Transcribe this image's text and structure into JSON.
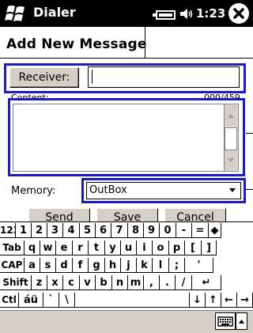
{
  "app": {
    "title": "Dialer",
    "clock": "1:23"
  },
  "page": {
    "title": "Add New Message"
  },
  "receiver": {
    "button_label": "Receiver:",
    "value": ""
  },
  "content": {
    "label": "Content:",
    "counter": "000/459",
    "value": ""
  },
  "memory": {
    "label": "Memory:",
    "selected": "OutBox"
  },
  "actions": {
    "send": "Send",
    "save": "Save",
    "cancel": "Cancel"
  },
  "keyboard": {
    "rows": [
      [
        "123",
        "1",
        "2",
        "3",
        "4",
        "5",
        "6",
        "7",
        "8",
        "9",
        "0",
        "-",
        "=",
        "◆"
      ],
      [
        "Tab",
        "q",
        "w",
        "e",
        "r",
        "t",
        "y",
        "u",
        "i",
        "o",
        "p",
        "[",
        "]"
      ],
      [
        "CAP",
        "a",
        "s",
        "d",
        "f",
        "g",
        "h",
        "j",
        "k",
        "l",
        ";",
        "'"
      ],
      [
        "Shift",
        "z",
        "x",
        "c",
        "v",
        "b",
        "n",
        "m",
        ",",
        ".",
        "/",
        "↵"
      ],
      [
        "Ctl",
        "áü",
        "`",
        "\\",
        "",
        "↓",
        "↑",
        "←",
        "→"
      ]
    ]
  },
  "colors": {
    "highlight": "#1c1cc6",
    "titlebar": "#000000"
  },
  "icons": [
    "windows-logo-icon",
    "battery-icon",
    "volume-icon",
    "close-icon",
    "scroll-up-icon",
    "scroll-down-icon",
    "dropdown-arrow-icon",
    "keyboard-icon",
    "up-arrow-icon"
  ]
}
